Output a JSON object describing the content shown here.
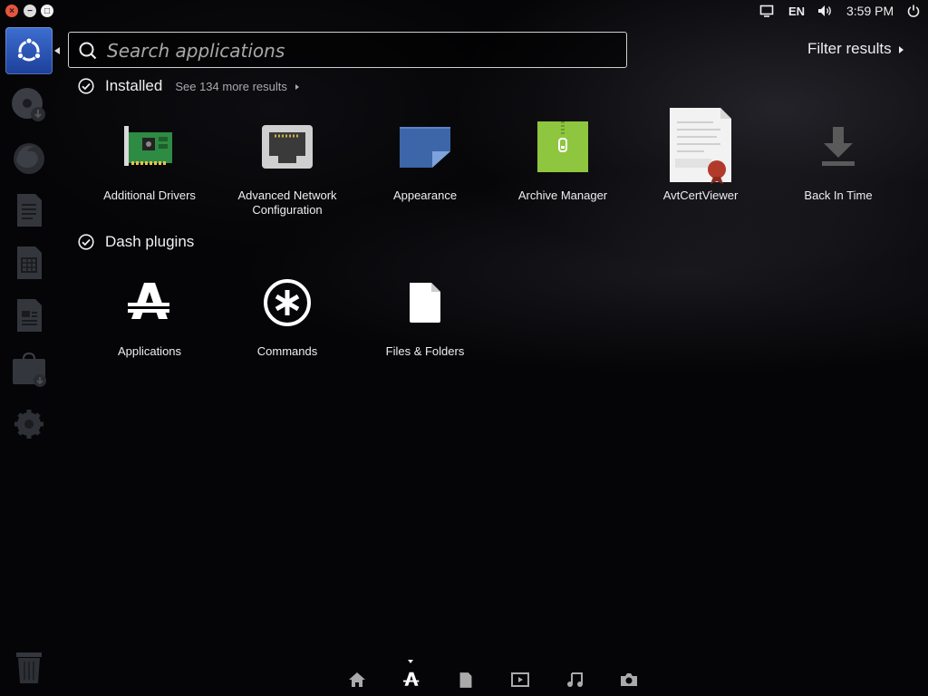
{
  "panel": {
    "keyboard_layout": "EN",
    "clock": "3:59 PM",
    "window_buttons": {
      "close": "×",
      "minimize": "−",
      "maximize": "□"
    }
  },
  "launcher": {
    "items": [
      {
        "id": "dash-home",
        "icon": "ubuntu-logo-icon"
      },
      {
        "id": "disc-installer",
        "icon": "disc-install-icon"
      },
      {
        "id": "firefox",
        "icon": "firefox-icon"
      },
      {
        "id": "writer",
        "icon": "writer-doc-icon"
      },
      {
        "id": "calc",
        "icon": "calc-sheet-icon"
      },
      {
        "id": "impress",
        "icon": "impress-slide-icon"
      },
      {
        "id": "software-center",
        "icon": "software-bag-icon"
      },
      {
        "id": "settings",
        "icon": "settings-wrench-icon"
      },
      {
        "id": "trash",
        "icon": "trash-icon"
      }
    ]
  },
  "search": {
    "placeholder": "Search applications",
    "value": ""
  },
  "filter": {
    "label": "Filter results"
  },
  "categories": {
    "installed": {
      "title": "Installed",
      "more": "See 134 more results",
      "apps": [
        {
          "label": "Additional Drivers",
          "icon": "pci-card-icon"
        },
        {
          "label": "Advanced Network Configuration",
          "icon": "network-port-icon"
        },
        {
          "label": "Appearance",
          "icon": "appearance-icon"
        },
        {
          "label": "Archive Manager",
          "icon": "archive-zip-icon"
        },
        {
          "label": "AvtCertViewer",
          "icon": "certificate-icon"
        },
        {
          "label": "Back In Time",
          "icon": "download-arrow-icon"
        }
      ]
    },
    "dash_plugins": {
      "title": "Dash plugins",
      "apps": [
        {
          "label": "Applications",
          "icon": "applications-lens-icon"
        },
        {
          "label": "Commands",
          "icon": "commands-asterisk-icon"
        },
        {
          "label": "Files & Folders",
          "icon": "file-icon"
        }
      ]
    }
  },
  "lenses": [
    {
      "id": "home",
      "icon": "home-icon"
    },
    {
      "id": "applications",
      "icon": "applications-lens-icon",
      "active": true
    },
    {
      "id": "files",
      "icon": "file-icon"
    },
    {
      "id": "video",
      "icon": "video-icon"
    },
    {
      "id": "music",
      "icon": "music-note-icon"
    },
    {
      "id": "photos",
      "icon": "camera-icon"
    }
  ],
  "colors": {
    "launcher_active": "#2a55b8",
    "background": "#050507",
    "archive_green": "#8ec63f",
    "driver_green": "#3a9a4a"
  }
}
